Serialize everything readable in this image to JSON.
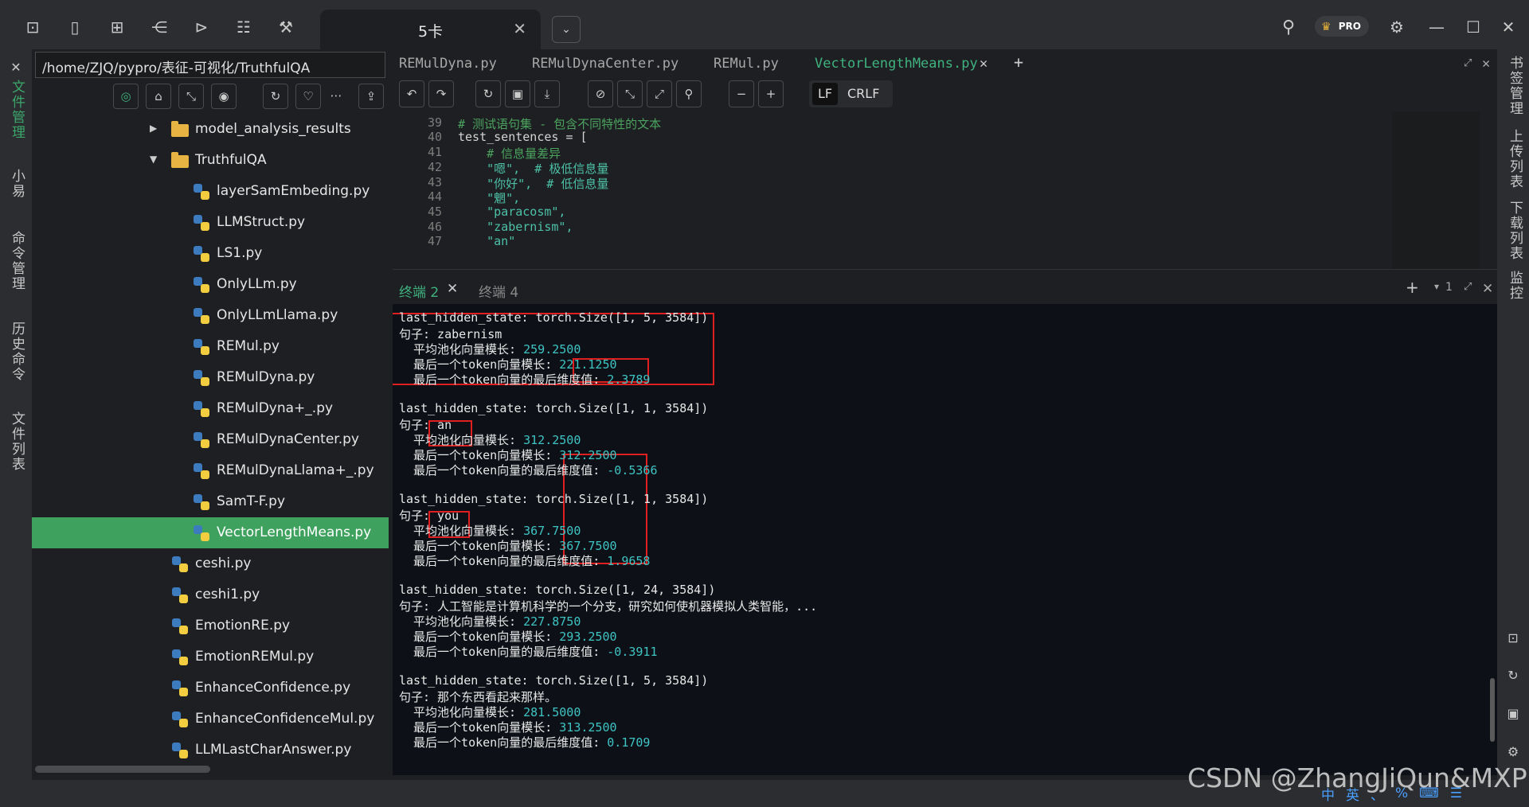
{
  "toolbar_top": {
    "icons": [
      "terminal-icon",
      "bookmark-icon",
      "grid-icon",
      "tree-icon",
      "console-icon",
      "database-icon",
      "wrench-icon"
    ],
    "window_tab": "5卡",
    "pro_badge": "PRO"
  },
  "left_strip": [
    "文件管理",
    "小易",
    "命令管理",
    "历史命令",
    "文件列表"
  ],
  "right_strip": [
    "书签管理",
    "上传列表",
    "下载列表",
    "监控"
  ],
  "sidebar": {
    "path": "/home/ZJQ/pypro/表征-可视化/TruthfulQA",
    "tree": [
      {
        "type": "folder",
        "name": "model_analysis_results",
        "expanded": false,
        "indent": 1
      },
      {
        "type": "folder",
        "name": "TruthfulQA",
        "expanded": true,
        "indent": 1
      },
      {
        "type": "py",
        "name": "layerSamEmbeding.py",
        "indent": 2
      },
      {
        "type": "py",
        "name": "LLMStruct.py",
        "indent": 2
      },
      {
        "type": "py",
        "name": "LS1.py",
        "indent": 2
      },
      {
        "type": "py",
        "name": "OnlyLLm.py",
        "indent": 2
      },
      {
        "type": "py",
        "name": "OnlyLLmLlama.py",
        "indent": 2
      },
      {
        "type": "py",
        "name": "REMul.py",
        "indent": 2
      },
      {
        "type": "py",
        "name": "REMulDyna.py",
        "indent": 2
      },
      {
        "type": "py",
        "name": "REMulDyna+_.py",
        "indent": 2
      },
      {
        "type": "py",
        "name": "REMulDynaCenter.py",
        "indent": 2
      },
      {
        "type": "py",
        "name": "REMulDynaLlama+_.py",
        "indent": 2
      },
      {
        "type": "py",
        "name": "SamT-F.py",
        "indent": 2
      },
      {
        "type": "py",
        "name": "VectorLengthMeans.py",
        "indent": 2,
        "selected": true
      },
      {
        "type": "py",
        "name": "ceshi.py",
        "indent": 1
      },
      {
        "type": "py",
        "name": "ceshi1.py",
        "indent": 1
      },
      {
        "type": "py",
        "name": "EmotionRE.py",
        "indent": 1
      },
      {
        "type": "py",
        "name": "EmotionREMul.py",
        "indent": 1
      },
      {
        "type": "py",
        "name": "EnhanceConfidence.py",
        "indent": 1
      },
      {
        "type": "py",
        "name": "EnhanceConfidenceMul.py",
        "indent": 1
      },
      {
        "type": "py",
        "name": "LLMLastCharAnswer.py",
        "indent": 1
      }
    ]
  },
  "editor": {
    "tabs": [
      "REMulDyna.py",
      "REMulDynaCenter.py",
      "REMul.py",
      "VectorLengthMeans.py"
    ],
    "active_tab": "VectorLengthMeans.py",
    "lf": "LF",
    "crlf": "CRLF",
    "lines": [
      {
        "n": "38",
        "text": ""
      },
      {
        "n": "39",
        "text": "# 测试语句集 - 包含不同特性的文本",
        "kind": "comment"
      },
      {
        "n": "40",
        "text": "test_sentences = ["
      },
      {
        "n": "41",
        "text": "    # 信息量差异",
        "kind": "comment"
      },
      {
        "n": "42",
        "text": "    \"嗯\",  # 极低信息量",
        "kind": "mixed"
      },
      {
        "n": "43",
        "text": "    \"你好\",  # 低信息量",
        "kind": "mixed"
      },
      {
        "n": "44",
        "text": "    \"魍\",",
        "kind": "string"
      },
      {
        "n": "45",
        "text": "    \"paracosm\",",
        "kind": "string"
      },
      {
        "n": "46",
        "text": "    \"zabernism\",",
        "kind": "string"
      },
      {
        "n": "47",
        "text": "    \"an\"",
        "kind": "string"
      }
    ]
  },
  "terminal": {
    "tabs": [
      "终端 2",
      "终端 4"
    ],
    "active_tab": "终端 2",
    "split_count": "1",
    "blocks": [
      {
        "state": "last_hidden_state: torch.Size([1, 5, 3584])",
        "sentence": "句子: zabernism",
        "pool": "259.2500",
        "last_norm": "221.1250",
        "last_dim": "2.3789"
      },
      {
        "state": "last_hidden_state: torch.Size([1, 1, 3584])",
        "sentence": "句子: an",
        "pool": "312.2500",
        "last_norm": "312.2500",
        "last_dim": "-0.5366"
      },
      {
        "state": "last_hidden_state: torch.Size([1, 1, 3584])",
        "sentence": "句子: you",
        "pool": "367.7500",
        "last_norm": "367.7500",
        "last_dim": "1.9658"
      },
      {
        "state": "last_hidden_state: torch.Size([1, 24, 3584])",
        "sentence": "句子: 人工智能是计算机科学的一个分支，研究如何使机器模拟人类智能，...",
        "pool": "227.8750",
        "last_norm": "293.2500",
        "last_dim": "-0.3911"
      },
      {
        "state": "last_hidden_state: torch.Size([1, 5, 3584])",
        "sentence": "句子: 那个东西看起来那样。",
        "pool": "281.5000",
        "last_norm": "313.2500",
        "last_dim": "0.1709"
      }
    ],
    "labels": {
      "pool": "  平均池化向量模长: ",
      "last_norm": "  最后一个token向量模长: ",
      "last_dim": "  最后一个token向量的最后维度值: "
    }
  },
  "watermark": "CSDN @ZhangJiQun&MXP",
  "ime": [
    "中",
    "英",
    "、",
    "%",
    "⌨",
    "☰"
  ]
}
